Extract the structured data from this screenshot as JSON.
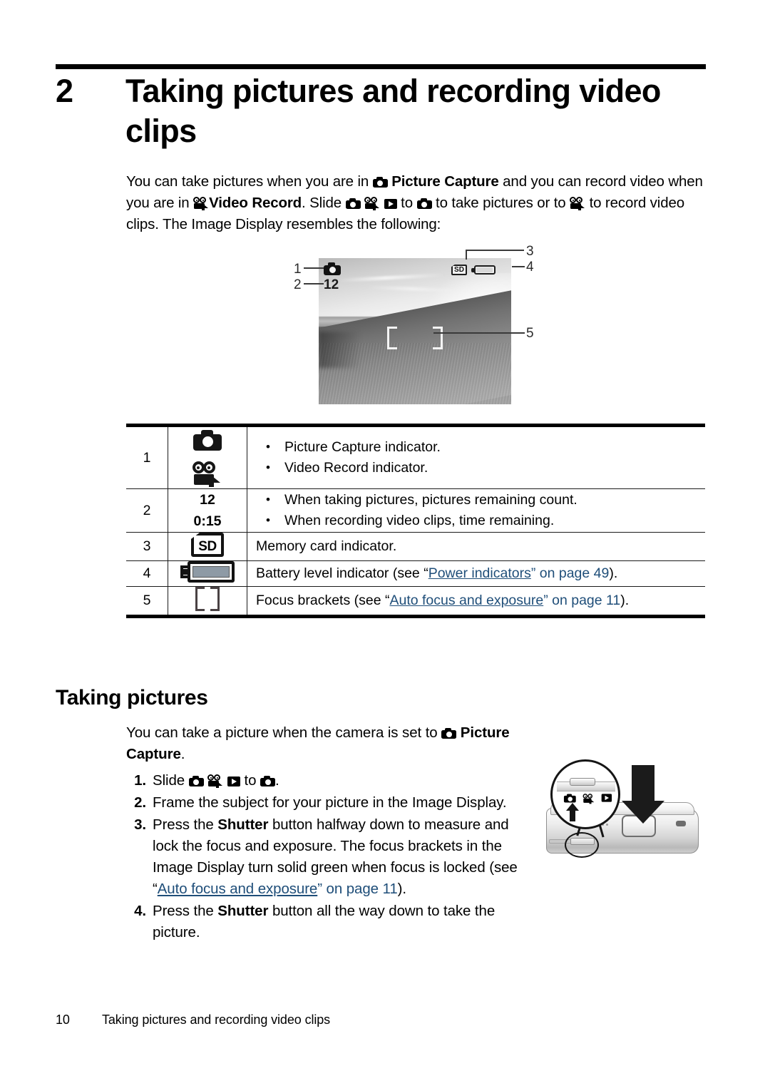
{
  "chapter": {
    "number": "2",
    "title": "Taking pictures and recording video clips"
  },
  "intro": {
    "p1_a": "You can take pictures when you are in ",
    "p1_b": "Picture Capture",
    "p1_c": " and you can record video when you are in ",
    "p1_d": "Video Record",
    "p1_e": ". Slide ",
    "p1_f": " to ",
    "p1_g": " to take pictures or to ",
    "p1_h": " to record video clips. The Image Display resembles the following:"
  },
  "figure": {
    "osd": {
      "picture_count": "12",
      "sd_label": "SD"
    },
    "callouts": [
      "1",
      "2",
      "3",
      "4",
      "5"
    ]
  },
  "table": {
    "rows": [
      {
        "num": "1",
        "icon": "camera-and-video-icons",
        "bullets": [
          "Picture Capture indicator.",
          "Video Record indicator."
        ]
      },
      {
        "num": "2",
        "icon": "count-values",
        "value_top": "12",
        "value_bottom": "0:15",
        "bullets": [
          "When taking pictures, pictures remaining count.",
          "When recording video clips, time remaining."
        ]
      },
      {
        "num": "3",
        "icon": "sd-card-icon",
        "sd_label": "SD",
        "text": "Memory card indicator."
      },
      {
        "num": "4",
        "icon": "battery-icon",
        "text_a": "Battery level indicator (see “",
        "link": "Power indicators",
        "text_b": "” on page 49",
        "text_c": ")."
      },
      {
        "num": "5",
        "icon": "focus-brackets-icon",
        "text_a": "Focus brackets (see “",
        "link": "Auto focus and exposure",
        "text_b": "” on page 11",
        "text_c": ")."
      }
    ]
  },
  "section": {
    "heading": "Taking pictures",
    "lead_a": "You can take a picture when the camera is set to ",
    "lead_b": "Picture Capture",
    "lead_c": ".",
    "steps": [
      {
        "num": "1.",
        "text_a": "Slide ",
        "text_b": " to ",
        "text_c": "."
      },
      {
        "num": "2.",
        "text": "Frame the subject for your picture in the Image Display."
      },
      {
        "num": "3.",
        "text_a": "Press the ",
        "bold": "Shutter",
        "text_b": " button halfway down to measure and lock the focus and exposure. The focus brackets in the Image Display turn solid green when focus is locked (see “",
        "link": "Auto focus and exposure",
        "text_c": "” on page 11",
        "text_d": ")."
      },
      {
        "num": "4.",
        "text_a": "Press the ",
        "bold": "Shutter",
        "text_b": " button all the way down to take the picture."
      }
    ]
  },
  "footer": {
    "page_number": "10",
    "title": "Taking pictures and recording video clips"
  },
  "colors": {
    "link": "#1f4e79",
    "rule": "#000000",
    "battery_fill": "#8e9aa5"
  }
}
